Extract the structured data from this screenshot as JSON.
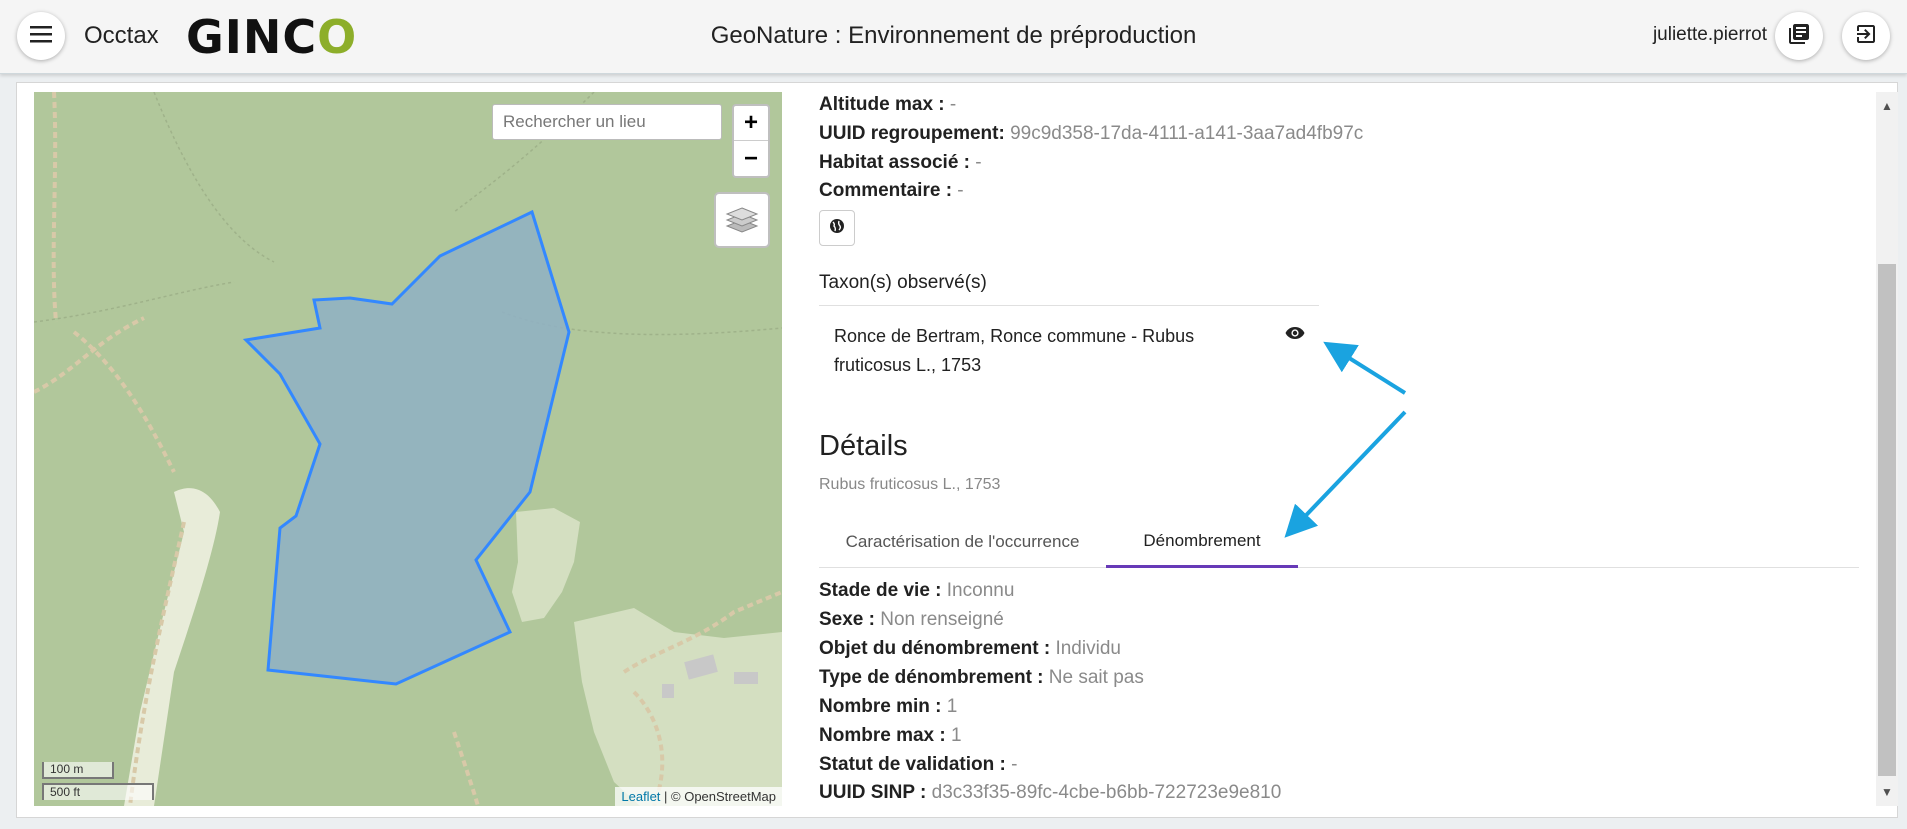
{
  "header": {
    "app_name": "Occtax",
    "logo_main": "GINC",
    "logo_accent": "O",
    "title": "GeoNature : Environnement de préproduction",
    "username": "juliette.pierrot"
  },
  "map": {
    "search_placeholder": "Rechercher un lieu",
    "zoom_in": "+",
    "zoom_out": "−",
    "scale_metric": "100 m",
    "scale_imperial": "500 ft",
    "attribution_link": "Leaflet",
    "attribution_text": " | © OpenStreetMap"
  },
  "releve": {
    "altitude_max_label": "Altitude max :",
    "altitude_max_value": " -",
    "uuid_label": "UUID regroupement:",
    "uuid_value": " 99c9d358-17da-4111-a141-3aa7ad4fb97c",
    "habitat_label": "Habitat associé :",
    "habitat_value": " -",
    "comment_label": "Commentaire :",
    "comment_value": " -"
  },
  "taxa": {
    "header": "Taxon(s) observé(s)",
    "items": [
      {
        "label": "Ronce de Bertram, Ronce commune - Rubus fruticosus L., 1753"
      }
    ]
  },
  "details": {
    "title": "Détails",
    "subtitle": "Rubus fruticosus L., 1753",
    "tabs": [
      "Caractérisation de l'occurrence",
      "Dénombrement"
    ],
    "active_tab": "Dénombrement",
    "fields": [
      {
        "label": "Stade de vie :",
        "value": " Inconnu"
      },
      {
        "label": "Sexe :",
        "value": " Non renseigné"
      },
      {
        "label": "Objet du dénombrement :",
        "value": " Individu"
      },
      {
        "label": "Type de dénombrement :",
        "value": " Ne sait pas"
      },
      {
        "label": "Nombre min :",
        "value": " 1"
      },
      {
        "label": "Nombre max :",
        "value": " 1"
      },
      {
        "label": "Statut de validation :",
        "value": " -"
      },
      {
        "label": "UUID SINP :",
        "value": " d3c33f35-89fc-4cbe-b6bb-722723e9e810"
      }
    ]
  },
  "colors": {
    "accent_tab": "#673ab7",
    "polygon_stroke": "#3388ff",
    "annotation_arrow": "#1aa3e0",
    "logo_green": "#8dae2a"
  }
}
